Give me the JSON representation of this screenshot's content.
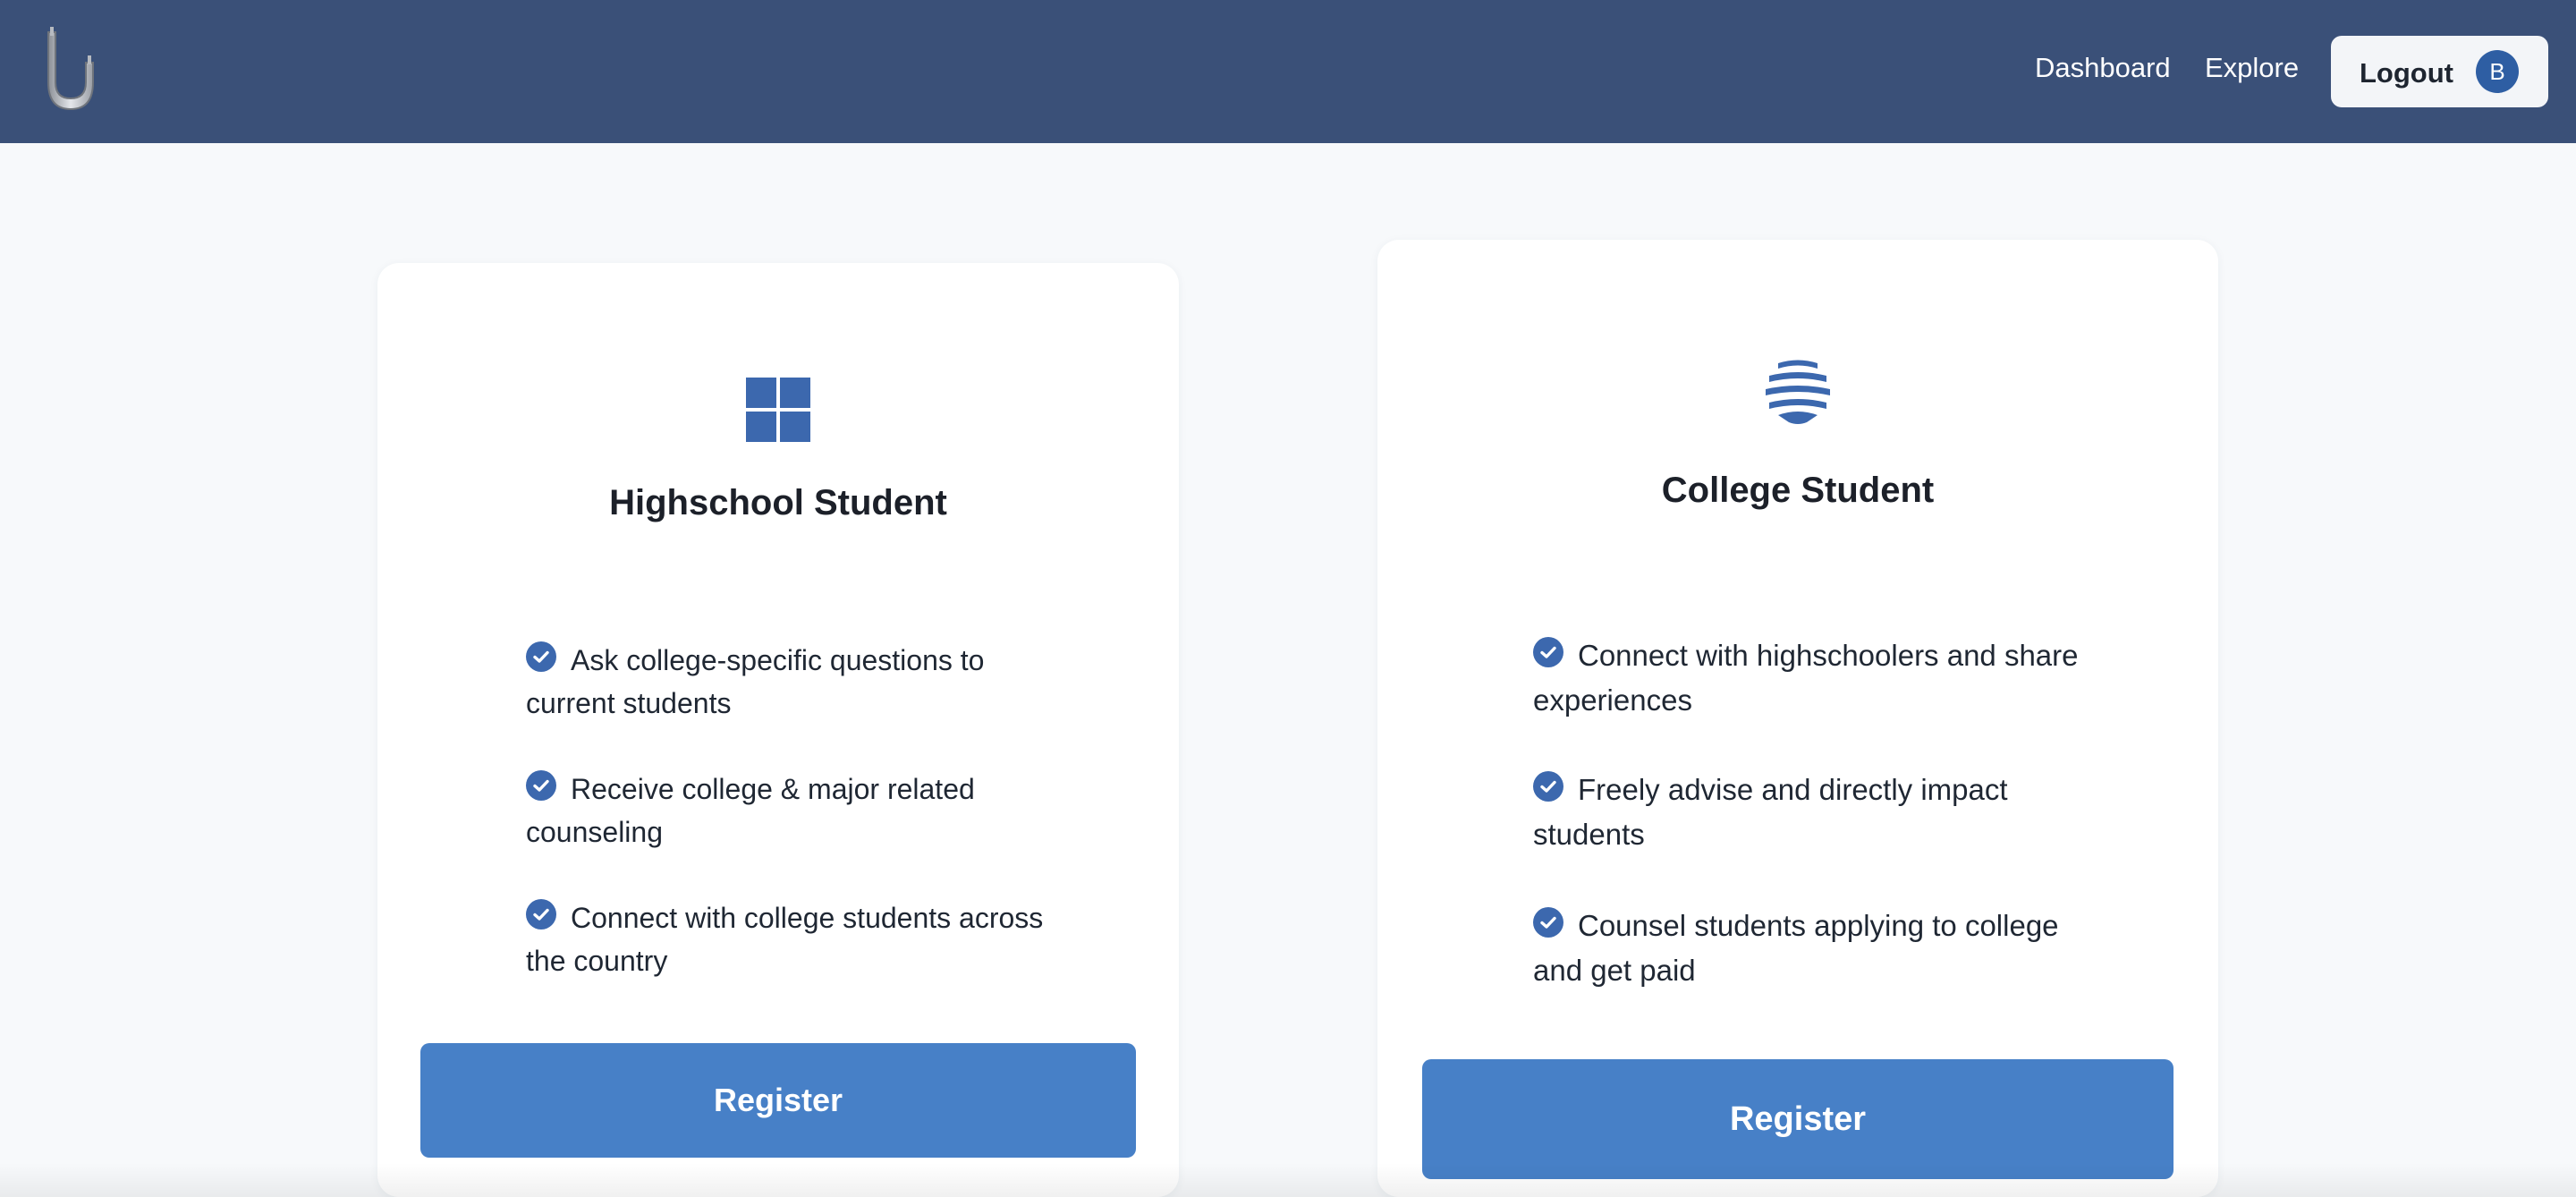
{
  "navbar": {
    "logo_icon": "u-pillar-logo-icon",
    "links": [
      "Dashboard",
      "Explore"
    ],
    "logout_label": "Logout",
    "avatar_initial": "B"
  },
  "cards": [
    {
      "icon": "windows-grid-icon",
      "title": "Highschool Student",
      "features": [
        "Ask college-specific questions to current students",
        "Receive college & major related counseling",
        "Connect with college students across the country"
      ],
      "button_label": "Register"
    },
    {
      "icon": "stacked-layers-icon",
      "title": "College Student",
      "features": [
        "Connect with highschoolers and share experiences",
        "Freely advise and directly impact students",
        "Counsel students applying to college and get paid"
      ],
      "button_label": "Register"
    }
  ],
  "colors": {
    "navbar": "#3a5078",
    "accent": "#4780c7",
    "icon": "#3c68ae",
    "background": "#f7f9fb"
  }
}
